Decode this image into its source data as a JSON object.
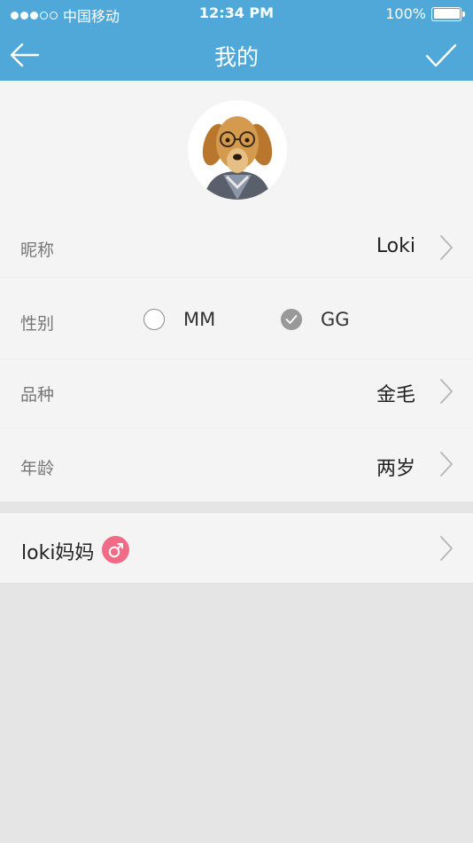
{
  "status_bar": {
    "carrier": "中国移动",
    "time": "12:34 PM",
    "battery": "100%",
    "signal_bars_filled": 3,
    "signal_bars_total": 5
  },
  "nav": {
    "title": "我的",
    "back_icon": "arrow-left-icon",
    "done_icon": "checkmark-icon"
  },
  "profile": {
    "avatar_icon": "dog-avatar-icon",
    "fields": [
      {
        "label": "昵称",
        "value": "Loki"
      },
      {
        "label": "性别",
        "options": [
          "MM",
          "GG"
        ],
        "selected": "GG"
      },
      {
        "label": "品种",
        "value": "金毛"
      },
      {
        "label": "年龄",
        "value": "两岁"
      }
    ]
  },
  "owner": {
    "name": "loki妈妈",
    "badge_icon": "male-symbol-icon"
  },
  "colors": {
    "primary": "#4fa8d8",
    "badge": "#f06b86",
    "background": "#e5e5e5",
    "panel": "#f4f4f4"
  }
}
